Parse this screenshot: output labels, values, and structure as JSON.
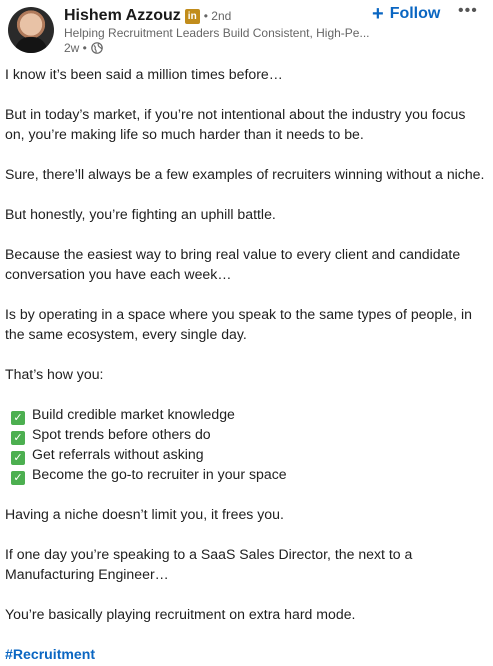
{
  "author": {
    "name": "Hishem Azzouz",
    "badge": "in",
    "degree": "• 2nd",
    "headline": "Helping Recruitment Leaders Build Consistent, High-Pe...",
    "time": "2w •",
    "avatar_icon": "profile-photo",
    "visibility_icon": "globe-icon"
  },
  "actions": {
    "follow_label": "Follow",
    "follow_icon": "+",
    "more_label": "•••"
  },
  "colors": {
    "link": "#0a66c2",
    "check": "#4caf50",
    "badge": "#c18c1b"
  },
  "post": {
    "lines": [
      "I know it’s been said a million times before…",
      "But in today’s market, if you’re not intentional about the industry you focus",
      "on, you’re making life so much harder than it needs to be.",
      "Sure, there’ll always be a few examples of recruiters winning without a niche.",
      "But honestly, you’re fighting an uphill battle.",
      "Because the easiest way to bring real value to every client and candidate",
      "conversation you have each week…",
      "Is by operating in a space where you speak to the same types of people, in",
      "the same ecosystem, every single day.",
      "That’s how you:"
    ],
    "checklist": [
      "Build credible market knowledge",
      "Spot trends before others do",
      "Get referrals without asking",
      "Become the go-to recruiter in your space"
    ],
    "closing": [
      "Having a niche doesn’t limit you, it frees you.",
      "If one day you’re speaking to a SaaS Sales Director, the next to a",
      "Manufacturing Engineer…",
      "You’re basically playing recruitment on extra hard mode."
    ],
    "check_symbol": "✓",
    "hashtag": "#Recruitment"
  }
}
